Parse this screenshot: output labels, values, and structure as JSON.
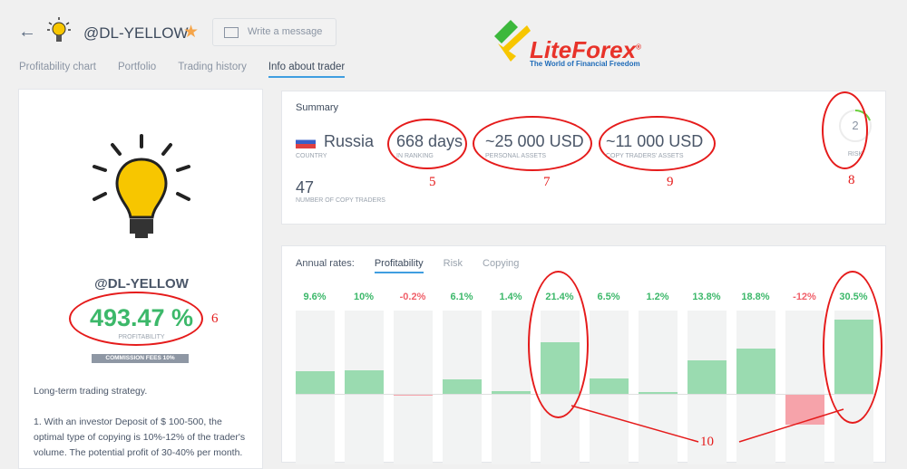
{
  "header": {
    "back": "←",
    "trader": "@DL-YELLOW",
    "star": "★",
    "message_placeholder": "Write a message"
  },
  "tabs": [
    "Profitability chart",
    "Portfolio",
    "Trading history",
    "Info about trader"
  ],
  "logo": {
    "name": "LiteForex",
    "reg": "®",
    "tagline": "The World of Financial Freedom"
  },
  "profile": {
    "name": "@DL-YELLOW",
    "profitability": "493.47 %",
    "profitability_label": "PROFITABILITY",
    "commission": "COMMISSION FEES 10%",
    "desc1": "Long-term trading strategy.",
    "desc2": "1. With an investor Deposit of $ 100-500, the optimal type of copying is 10%-12% of the trader's volume. The potential profit of 30-40% per month."
  },
  "summary": {
    "title": "Summary",
    "country": "Russia",
    "country_label": "COUNTRY",
    "days": "668 days",
    "days_label": "IN RANKING",
    "personal": "~25 000 USD",
    "personal_label": "PERSONAL ASSETS",
    "copy_assets": "~11 000 USD",
    "copy_assets_label": "COPY TRADERS' ASSETS",
    "risk": "2",
    "risk_label": "RISK",
    "copy_traders": "47",
    "copy_traders_label": "NUMBER OF COPY TRADERS"
  },
  "annotations": {
    "n5": "5",
    "n6": "6",
    "n7": "7",
    "n8": "8",
    "n9": "9",
    "n10": "10"
  },
  "rates": {
    "label": "Annual rates:",
    "tabs": [
      "Profitability",
      "Risk",
      "Copying"
    ]
  },
  "colors": {
    "positive": "#3cb86a",
    "negative": "#f0606a",
    "bar_pos": "#9adbb0",
    "bar_neg": "#f6a3aa"
  },
  "chart_data": {
    "type": "bar",
    "title": "Annual rates: Profitability",
    "values": [
      9.6,
      10,
      -0.2,
      6.1,
      1.4,
      21.4,
      6.5,
      1.2,
      13.8,
      18.8,
      -12,
      30.5
    ],
    "labels": [
      "9.6%",
      "10%",
      "-0.2%",
      "6.1%",
      "1.4%",
      "21.4%",
      "6.5%",
      "1.2%",
      "13.8%",
      "18.8%",
      "-12%",
      "30.5%"
    ]
  }
}
